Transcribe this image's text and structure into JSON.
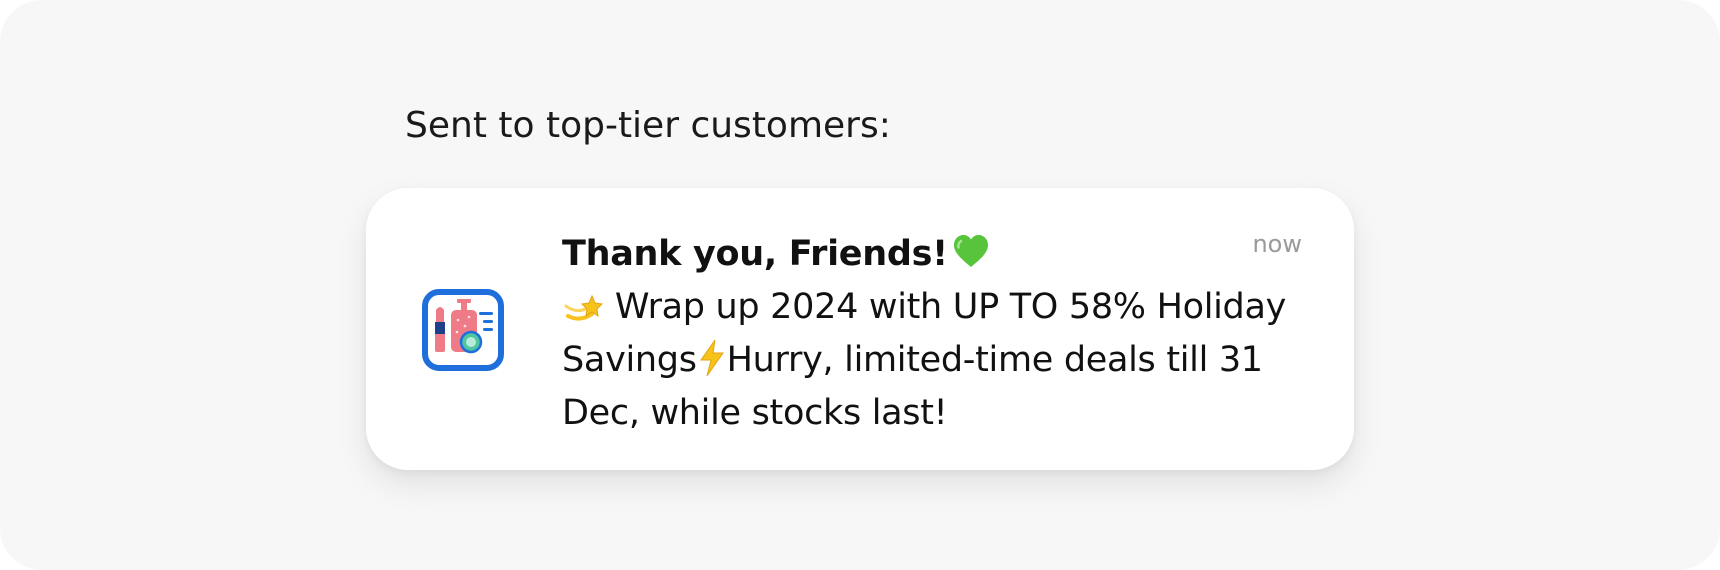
{
  "caption": "Sent to top-tier customers:",
  "notification": {
    "app_icon": "beauty-cosmetics-app-icon",
    "title": "Thank you, Friends!",
    "title_emoji": "green-heart-icon",
    "timestamp": "now",
    "message": {
      "emoji_start": "dizzy-star-icon",
      "part1": "Wrap up 2024 with UP TO 58% Holiday Savings",
      "emoji_mid": "lightning-bolt-icon",
      "part2": "Hurry, limited-time deals till 31 Dec, while stocks last!"
    }
  },
  "colors": {
    "frame_background": "#f7f7f7",
    "card_background": "#ffffff",
    "icon_blue": "#1e6fdc",
    "heart_green": "#58c43c",
    "bolt_yellow": "#f7c21a",
    "timestamp_gray": "#9a9a9a"
  }
}
